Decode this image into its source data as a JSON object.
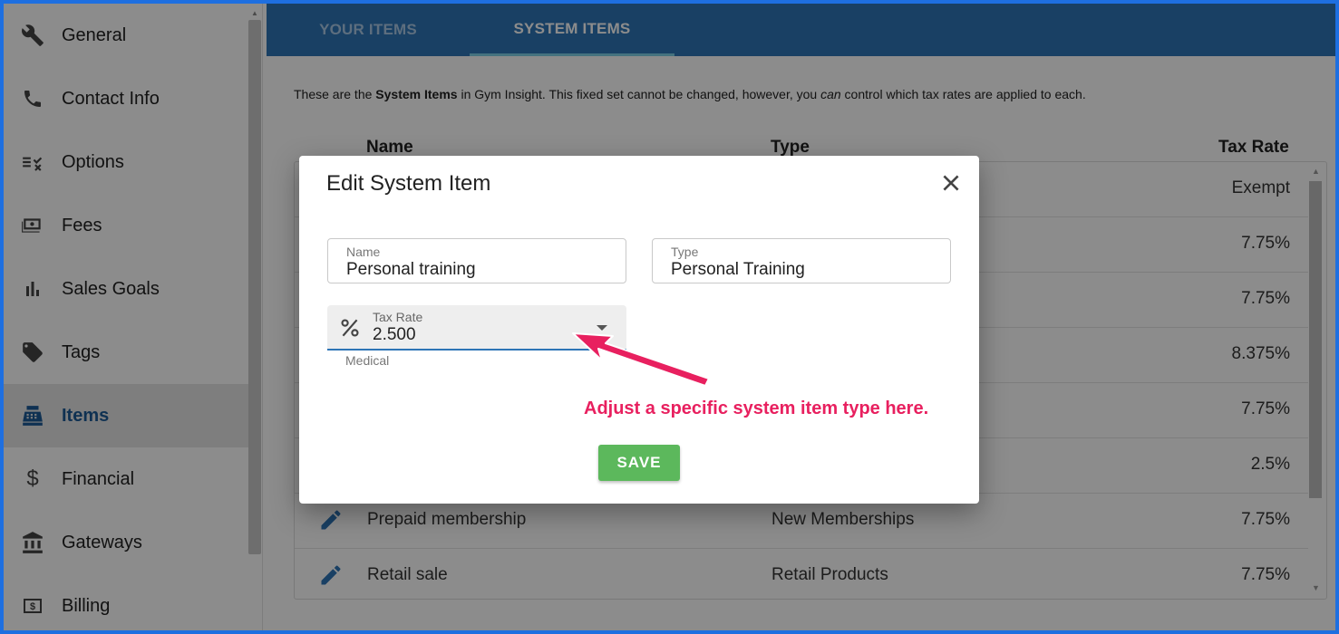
{
  "sidebar": {
    "items": [
      {
        "label": "General",
        "icon": "wrench-icon"
      },
      {
        "label": "Contact Info",
        "icon": "phone-icon"
      },
      {
        "label": "Options",
        "icon": "checklist-icon"
      },
      {
        "label": "Fees",
        "icon": "cash-icon"
      },
      {
        "label": "Sales Goals",
        "icon": "bar-chart-icon"
      },
      {
        "label": "Tags",
        "icon": "tag-icon"
      },
      {
        "label": "Items",
        "icon": "cash-register-icon",
        "active": true
      },
      {
        "label": "Financial",
        "icon": "dollar-icon"
      },
      {
        "label": "Gateways",
        "icon": "bank-icon"
      },
      {
        "label": "Billing",
        "icon": "billing-icon"
      }
    ]
  },
  "tabs": [
    {
      "label": "YOUR ITEMS",
      "active": false
    },
    {
      "label": "SYSTEM ITEMS",
      "active": true
    }
  ],
  "main": {
    "desc_prefix": "These are the ",
    "desc_bold": "System Items",
    "desc_mid": " in Gym Insight. This fixed set cannot be changed, however, you ",
    "desc_italic": "can",
    "desc_suffix": " control which tax rates are applied to each."
  },
  "table": {
    "headers": {
      "name": "Name",
      "type": "Type",
      "tax_rate": "Tax Rate"
    },
    "rows": [
      {
        "name": "",
        "type": "",
        "tax_rate": "Exempt"
      },
      {
        "name": "",
        "type": "",
        "tax_rate": "7.75%"
      },
      {
        "name": "",
        "type": "",
        "tax_rate": "7.75%"
      },
      {
        "name": "",
        "type": "",
        "tax_rate": "8.375%"
      },
      {
        "name": "",
        "type": "",
        "tax_rate": "7.75%"
      },
      {
        "name": "",
        "type": "",
        "tax_rate": "2.5%"
      },
      {
        "name": "Prepaid membership",
        "type": "New Memberships",
        "tax_rate": "7.75%"
      },
      {
        "name": "Retail sale",
        "type": "Retail Products",
        "tax_rate": "7.75%"
      }
    ]
  },
  "dialog": {
    "title": "Edit System Item",
    "name_label": "Name",
    "name_value": "Personal training",
    "type_label": "Type",
    "type_value": "Personal Training",
    "tax_label": "Tax Rate",
    "tax_value": "2.500",
    "tax_helper": "Medical",
    "save_label": "SAVE"
  },
  "annotation": {
    "text": "Adjust a specific system item type here.",
    "color": "#e8205f"
  },
  "colors": {
    "accent": "#2e75b6",
    "save_green": "#5cb85c",
    "active_nav": "#1d5a96"
  }
}
